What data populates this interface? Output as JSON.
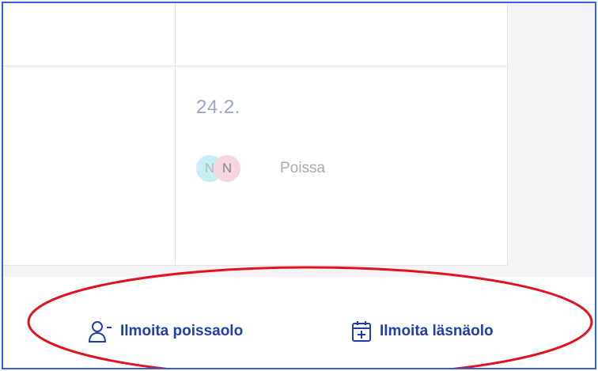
{
  "calendar": {
    "day": {
      "date_label": "24.2.",
      "entry": {
        "avatars": [
          "N",
          "N"
        ],
        "status": "Poissa"
      }
    }
  },
  "actions": {
    "report_absence": {
      "label": "Ilmoita poissaolo",
      "icon": "person-minus-icon"
    },
    "report_presence": {
      "label": "Ilmoita läsnäolo",
      "icon": "calendar-plus-icon"
    }
  },
  "colors": {
    "frame_border": "#2f62d6",
    "action_text": "#1f3fa6",
    "highlight_ellipse": "#e0141e",
    "date_text": "#9aa6c2",
    "avatar_1_bg": "#c6f0f5",
    "avatar_2_bg": "#f8d6dd"
  }
}
